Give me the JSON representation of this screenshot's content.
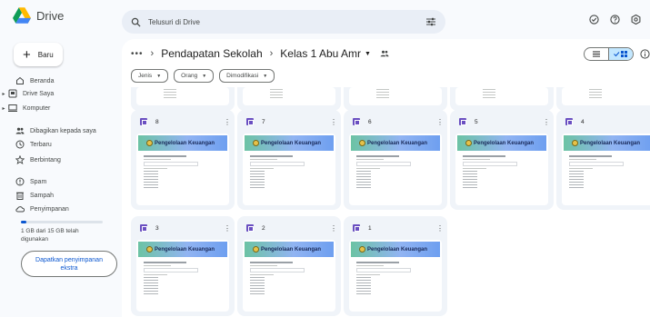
{
  "app": {
    "name": "Drive"
  },
  "search": {
    "placeholder": "Telusuri di Drive"
  },
  "new_button": {
    "label": "Baru"
  },
  "sidebar": {
    "items": [
      {
        "label": "Beranda",
        "icon": "home-icon"
      },
      {
        "label": "Drive Saya",
        "icon": "my-drive-icon"
      },
      {
        "label": "Komputer",
        "icon": "computer-icon"
      },
      {
        "label": "Dibagikan kepada saya",
        "icon": "shared-icon"
      },
      {
        "label": "Terbaru",
        "icon": "clock-icon"
      },
      {
        "label": "Berbintang",
        "icon": "star-icon"
      },
      {
        "label": "Spam",
        "icon": "spam-icon"
      },
      {
        "label": "Sampah",
        "icon": "trash-icon"
      },
      {
        "label": "Penyimpanan",
        "icon": "cloud-icon"
      }
    ],
    "storage": {
      "text": "1 GB dari 15 GB telah digunakan",
      "used_fraction": 0.067
    },
    "get_storage_label": "Dapatkan penyimpanan ekstra"
  },
  "breadcrumb": {
    "more": "•••",
    "items": [
      "Pendapatan Sekolah",
      "Kelas 1 Abu Amr"
    ]
  },
  "filters": [
    "Jenis",
    "Orang",
    "Dimodifikasi"
  ],
  "files": [
    {
      "title": "8",
      "banner": "Pengelolaan Keuangan"
    },
    {
      "title": "7",
      "banner": "Pengelolaan Keuangan"
    },
    {
      "title": "6",
      "banner": "Pengelolaan Keuangan"
    },
    {
      "title": "5",
      "banner": "Pengelolaan Keuangan"
    },
    {
      "title": "4",
      "banner": "Pengelolaan Keuangan"
    },
    {
      "title": "3",
      "banner": "Pengelolaan Keuangan"
    },
    {
      "title": "2",
      "banner": "Pengelolaan Keuangan"
    },
    {
      "title": "1",
      "banner": "Pengelolaan Keuangan"
    }
  ],
  "colors": {
    "accent": "#0b57d0",
    "sheet_icon": "#6a4fc1",
    "selected_view": "#c2e7ff"
  }
}
